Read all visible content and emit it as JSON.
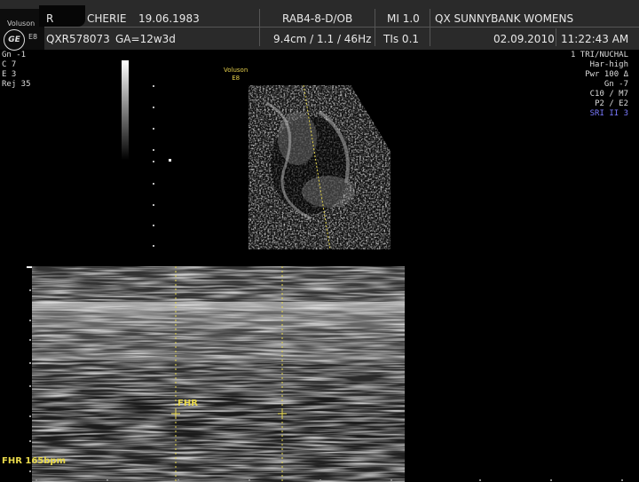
{
  "header": {
    "patient_name_visible": "R",
    "patient_name_tail": "CHERIE",
    "dob": "19.06.1983",
    "patient_id": "QXR578073",
    "ga": "GA=12w3d",
    "probe": "RAB4-8-D/OB",
    "depth_info": "9.4cm / 1.1 / 46Hz",
    "mi": "MI  1.0",
    "tis": "TIs  0.1",
    "institution": "QX SUNNYBANK WOMENS",
    "date": "02.09.2010",
    "time": "11:22:43 AM"
  },
  "logo": {
    "brand": "Voluson",
    "model": "E8",
    "ge": "GE"
  },
  "left_params": [
    "Gn  -1",
    "C  7",
    "E  3",
    "Rej  35"
  ],
  "right_params": [
    {
      "text": "1 TRI/NUCHAL",
      "color": "#dddddd"
    },
    {
      "text": "Har-high",
      "color": "#dddddd"
    },
    {
      "text": "Pwr 100 Δ",
      "color": "#dddddd"
    },
    {
      "text": "Gn  -7",
      "color": "#dddddd"
    },
    {
      "text": "C10 / M7",
      "color": "#dddddd"
    },
    {
      "text": "P2 / E2",
      "color": "#dddddd"
    },
    {
      "text": "SRI II 3",
      "color": "#7a7aff"
    }
  ],
  "overlay_logo": {
    "brand": "Voluson",
    "model": "E8"
  },
  "mmode": {
    "cursor_label": "FHR",
    "result": "FHR 165bpm"
  },
  "colors": {
    "accent_yellow": "#e8d84a",
    "header_bg": "#2a2a2a",
    "sri_blue": "#7a7aff"
  }
}
